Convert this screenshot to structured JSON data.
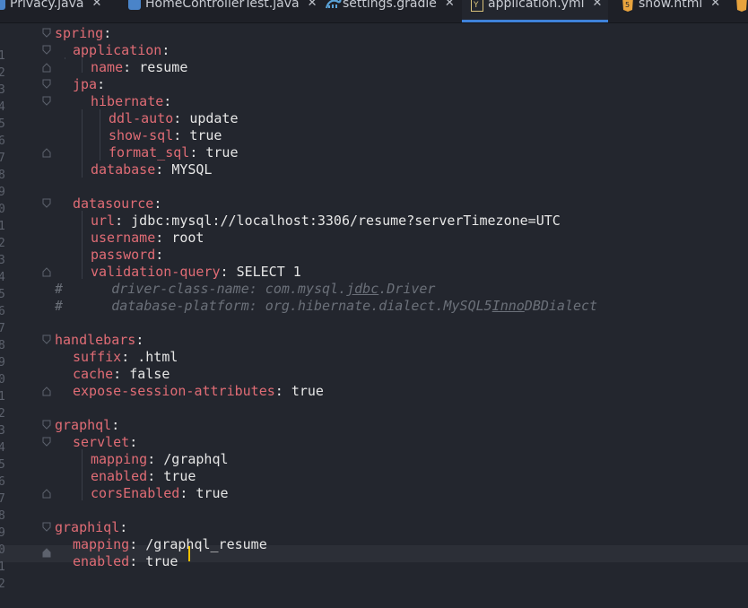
{
  "tabs": [
    {
      "label": "Privacy.java",
      "icon": "java-icon"
    },
    {
      "label": "HomeControllerTest.java",
      "icon": "java-icon"
    },
    {
      "label": "settings.gradle",
      "icon": "gradle-icon"
    },
    {
      "label": "application.yml",
      "icon": "yaml-icon",
      "active": true
    },
    {
      "label": "show.html",
      "icon": "html-icon"
    }
  ],
  "tab_close": "✕",
  "line_numbers": [
    "1",
    "2",
    "3",
    "4",
    "5",
    "6",
    "7",
    "8",
    "9",
    "0",
    "1",
    "2",
    "3",
    "4",
    "5",
    "6",
    "7",
    "8",
    "9",
    "0",
    "1",
    "2",
    "3",
    "4",
    "5",
    "6",
    "7",
    "8",
    "9",
    "0",
    "1",
    "2"
  ],
  "code": {
    "l1": {
      "key": "spring",
      "sep": ":"
    },
    "l2": {
      "key": "application",
      "sep": ":"
    },
    "l3": {
      "key": "name",
      "sep": ": ",
      "value": "resume"
    },
    "l4": {
      "key": "jpa",
      "sep": ":"
    },
    "l5": {
      "key": "hibernate",
      "sep": ":"
    },
    "l6": {
      "key": "ddl-auto",
      "sep": ": ",
      "value": "update"
    },
    "l7": {
      "key": "show-sql",
      "sep": ": ",
      "value": "true"
    },
    "l8": {
      "key": "format_sql",
      "sep": ": ",
      "value": "true"
    },
    "l9": {
      "key": "database",
      "sep": ": ",
      "value": "MYSQL"
    },
    "l11": {
      "key": "datasource",
      "sep": ":"
    },
    "l12": {
      "key": "url",
      "sep": ": ",
      "value": "jdbc:mysql://localhost:3306/resume?serverTimezone=UTC"
    },
    "l13": {
      "key": "username",
      "sep": ": ",
      "value": "root"
    },
    "l14": {
      "key": "password",
      "sep": ":"
    },
    "l15": {
      "key": "validation-query",
      "sep": ": ",
      "value": "SELECT 1"
    },
    "l16": {
      "hash": "#",
      "pre": "      driver-class-name: com.mysql.",
      "under": "jdbc",
      "post": ".Driver"
    },
    "l17": {
      "hash": "#",
      "pre": "      database-platform: org.hibernate.dialect.MySQL5",
      "under": "Inno",
      "post": "DBDialect"
    },
    "l19": {
      "key": "handlebars",
      "sep": ":"
    },
    "l20": {
      "key": "suffix",
      "sep": ": ",
      "value": ".html"
    },
    "l21": {
      "key": "cache",
      "sep": ": ",
      "value": "false"
    },
    "l22": {
      "key": "expose-session-attributes",
      "sep": ": ",
      "value": "true"
    },
    "l24": {
      "key": "graphql",
      "sep": ":"
    },
    "l25": {
      "key": "servlet",
      "sep": ":"
    },
    "l26": {
      "key": "mapping",
      "sep": ": ",
      "value": "/graphql"
    },
    "l27": {
      "key": "enabled",
      "sep": ": ",
      "value": "true"
    },
    "l28": {
      "key": "corsEnabled",
      "sep": ": ",
      "value": "true"
    },
    "l30": {
      "key": "graphiql",
      "sep": ":"
    },
    "l31": {
      "key": "mapping",
      "sep": ": ",
      "value": "/graphql_resume"
    },
    "l32": {
      "key": "enabled",
      "sep": ": ",
      "value": "true"
    }
  },
  "colors": {
    "key": "#e06c75",
    "comment": "#6b7079",
    "accent": "#3f82d9",
    "caret": "#f0c000"
  }
}
